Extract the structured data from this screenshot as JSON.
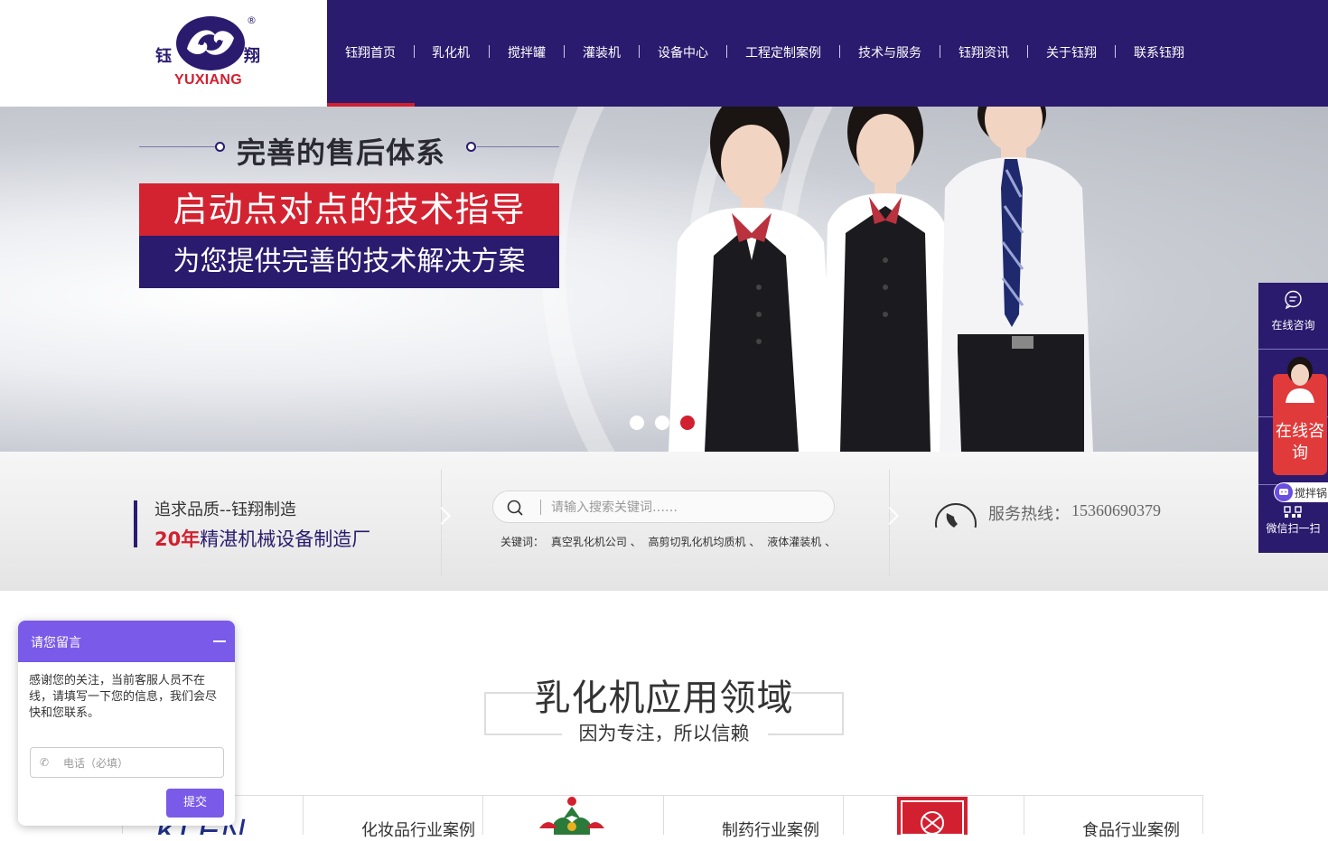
{
  "brand": {
    "name_left": "钰",
    "name_right": "翔",
    "name_en": "YUXIANG",
    "registered": "®"
  },
  "nav": {
    "items": [
      "钰翔首页",
      "乳化机",
      "搅拌罐",
      "灌装机",
      "设备中心",
      "工程定制案例",
      "技术与服务",
      "钰翔资讯",
      "关于钰翔",
      "联系钰翔"
    ],
    "active_index": 0
  },
  "banner": {
    "subtitle": "完善的售后体系",
    "headline": "启动点对点的技术指导",
    "tagline": "为您提供完善的技术解决方案",
    "slide_count": 3,
    "active_slide": 3
  },
  "info": {
    "slogan_line1": "追求品质--钰翔制造",
    "slogan_years": "20年",
    "slogan_line2_rest": "精湛机械设备制造厂",
    "search_placeholder": "请输入搜索关键词……",
    "keywords_label": "关键词：",
    "keywords": [
      "真空乳化机公司",
      "、",
      "高剪切乳化机均质机",
      "、",
      "液体灌装机",
      "、",
      "…"
    ],
    "hotline_label": "服务热线：",
    "hotline_number": "15360690379"
  },
  "section": {
    "title": "乳化机应用领域",
    "subtitle": "因为专注，所以信赖",
    "cases": [
      "化妆品行业案例",
      "制药行业案例",
      "食品行业案例"
    ],
    "logo_text": "KLEN"
  },
  "right_float": {
    "online_consult": "在线咨询",
    "consult_card": "在线咨询",
    "stir_label": "搅拌锅",
    "wechat_scan": "微信扫一扫"
  },
  "message_box": {
    "title": "请您留言",
    "body": "感谢您的关注，当前客服人员不在线，请填写一下您的信息，我们会尽快和您联系。",
    "phone_placeholder": "电话（必填）",
    "submit": "提交"
  },
  "colors": {
    "brand_navy": "#2a1b6e",
    "brand_red": "#d22030",
    "chat_purple": "#7a5ae8"
  }
}
